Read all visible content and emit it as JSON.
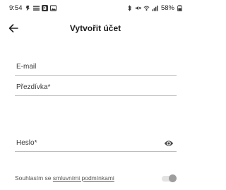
{
  "status_bar": {
    "time": "9:54",
    "battery": "58%",
    "left_icons": [
      "notification-icon",
      "menu-lines-icon",
      "app-b-icon",
      "image-icon"
    ],
    "right_icons": [
      "bluetooth-icon",
      "mute-icon",
      "wifi-icon",
      "signal-icon",
      "battery-icon"
    ]
  },
  "app_bar": {
    "title": "Vytvořit účet",
    "back_icon": "arrow-left-icon"
  },
  "form": {
    "email_label": "E-mail",
    "nickname_label": "Přezdívka*",
    "password_label": "Heslo*",
    "password_visibility_icon": "eye-icon"
  },
  "consent": {
    "text": "Souhlasím se ",
    "link": "smluvními podmínkami",
    "toggle_on": false
  },
  "colors": {
    "background": "#ffffff",
    "divider": "#bdbdbd",
    "toggle_track": "#e3e3e3",
    "toggle_thumb": "#9e9e9e"
  }
}
